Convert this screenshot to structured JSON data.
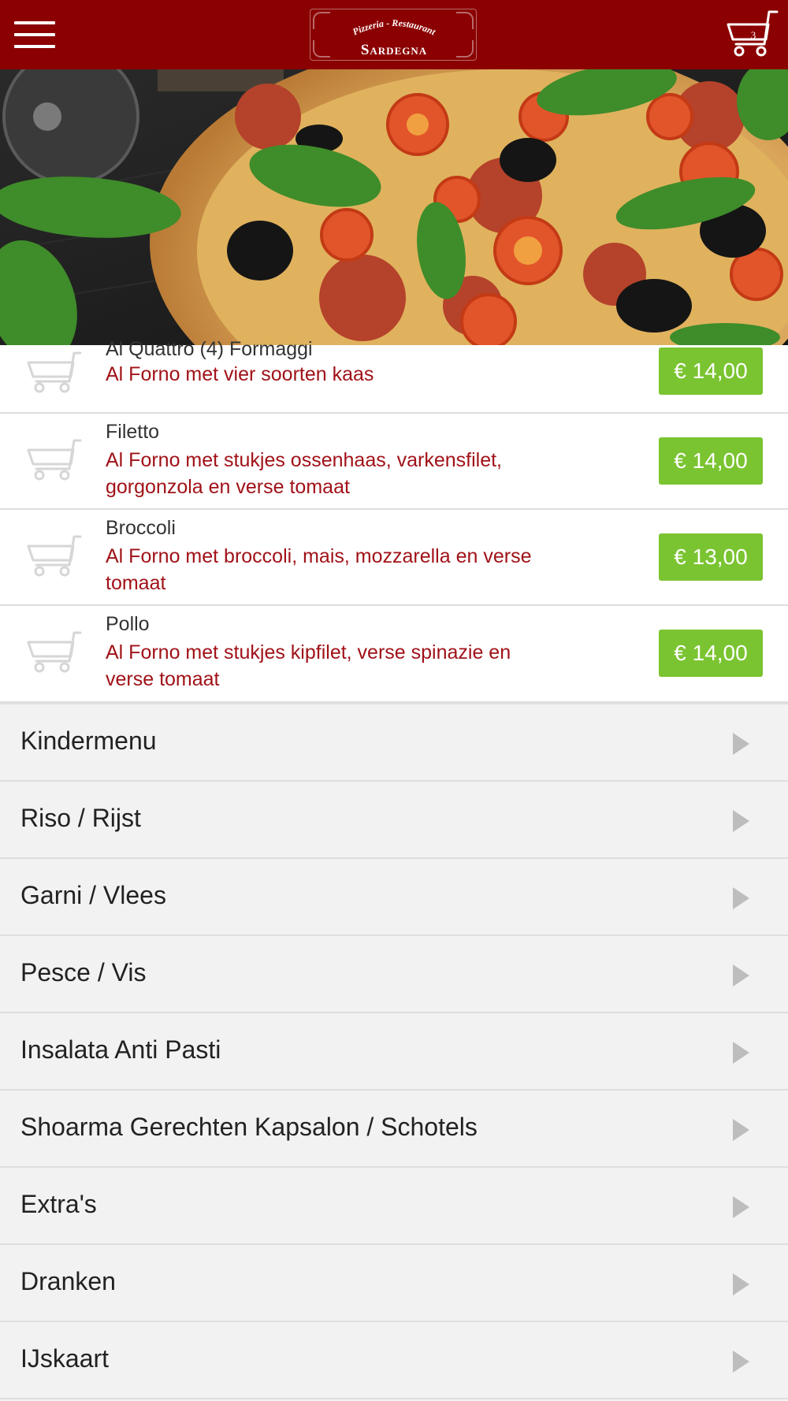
{
  "header": {
    "logo_top": "Pizzeria - Restaurant",
    "logo_name": "Sardegna",
    "cart_count": "3"
  },
  "hero": {
    "alt": "pizza-photo"
  },
  "products": [
    {
      "name": "Al Quattro (4) Formaggi",
      "description_lines": [
        "Al Forno met vier soorten kaas"
      ],
      "price": "€ 14,00"
    },
    {
      "name": "Filetto",
      "description_lines": [
        "Al Forno met stukjes ossenhaas, varkensfilet,",
        "gorgonzola en verse tomaat"
      ],
      "price": "€ 14,00"
    },
    {
      "name": "Broccoli",
      "description_lines": [
        "Al Forno met broccoli, mais, mozzarella en verse",
        "tomaat"
      ],
      "price": "€ 13,00"
    },
    {
      "name": "Pollo",
      "description_lines": [
        "Al Forno met stukjes kipfilet, verse spinazie en",
        "verse tomaat"
      ],
      "price": "€ 14,00"
    }
  ],
  "categories": [
    "Kindermenu",
    "Riso / Rijst",
    "Garni / Vlees",
    "Pesce / Vis",
    "Insalata Anti Pasti",
    "Shoarma Gerechten Kapsalon / Schotels",
    "Extra's",
    "Dranken",
    "IJskaart"
  ],
  "colors": {
    "header_bg": "#8b0000",
    "price_bg": "#7ac431",
    "description": "#a01218",
    "category_bg": "#f2f2f2"
  }
}
